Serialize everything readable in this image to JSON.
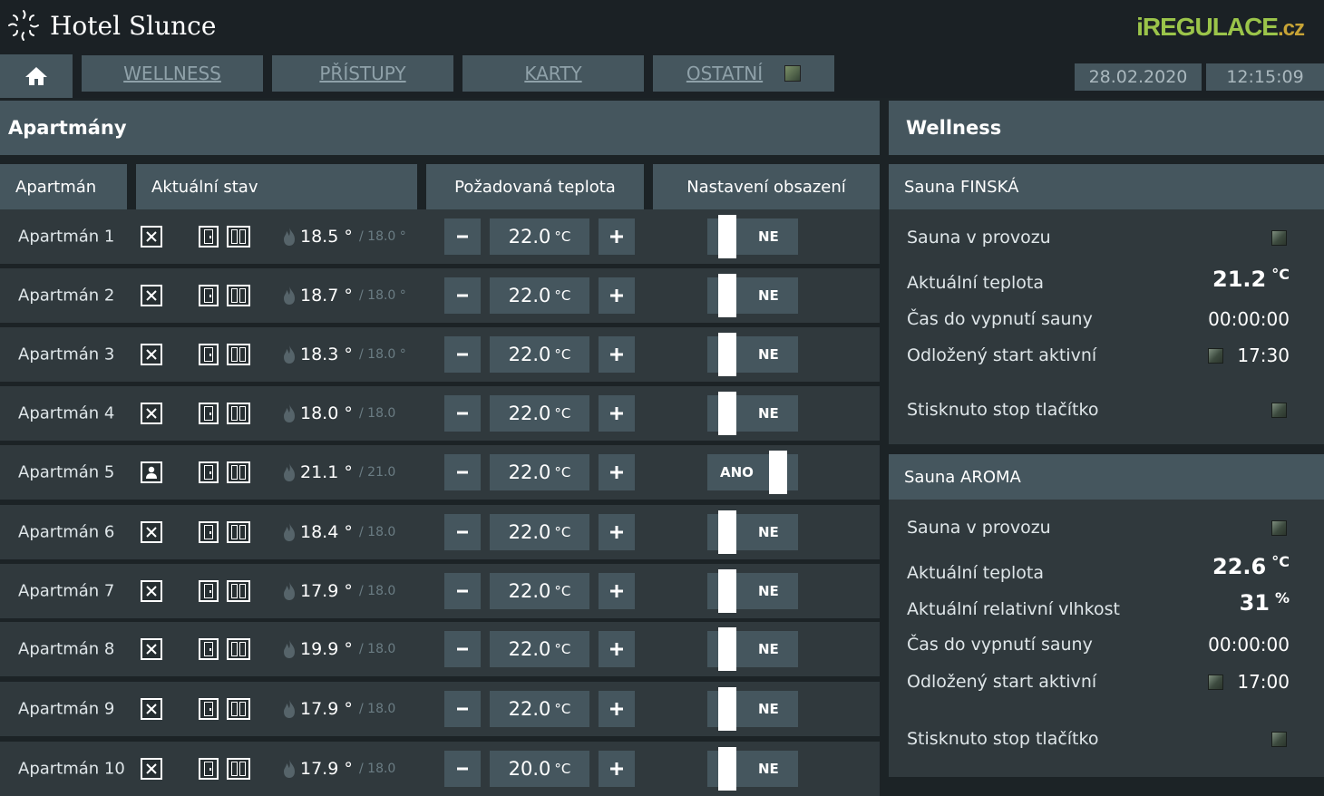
{
  "header": {
    "hotel_name": "Hotel Slunce",
    "brand_main": "iREGULACE",
    "brand_tld": ".cz",
    "home_icon": "home-icon"
  },
  "nav": {
    "tabs": [
      "WELLNESS",
      "PŘÍSTUPY",
      "KARTY",
      "OSTATNÍ"
    ],
    "date": "28.02.2020",
    "time": "12:15:09"
  },
  "apartments": {
    "title": "Apartmány",
    "columns": [
      "Apartmán",
      "Aktuální stav",
      "Požadovaná teplota",
      "Nastavení obsazení"
    ],
    "unit": "°C",
    "deg": "°",
    "rows": [
      {
        "name": "Apartmán 1",
        "temp": "18.5",
        "set": "18.0",
        "set_deg": true,
        "target": "22.0",
        "occupied": false,
        "occ_label": "NE"
      },
      {
        "name": "Apartmán 2",
        "temp": "18.7",
        "set": "18.0",
        "set_deg": true,
        "target": "22.0",
        "occupied": false,
        "occ_label": "NE"
      },
      {
        "name": "Apartmán 3",
        "temp": "18.3",
        "set": "18.0",
        "set_deg": true,
        "target": "22.0",
        "occupied": false,
        "occ_label": "NE"
      },
      {
        "name": "Apartmán 4",
        "temp": "18.0",
        "set": "18.0",
        "set_deg": false,
        "target": "22.0",
        "occupied": false,
        "occ_label": "NE"
      },
      {
        "name": "Apartmán 5",
        "temp": "21.1",
        "set": "21.0",
        "set_deg": false,
        "target": "22.0",
        "occupied": true,
        "occ_label": "ANO"
      },
      {
        "name": "Apartmán 6",
        "temp": "18.4",
        "set": "18.0",
        "set_deg": false,
        "target": "22.0",
        "occupied": false,
        "occ_label": "NE"
      },
      {
        "name": "Apartmán 7",
        "temp": "17.9",
        "set": "18.0",
        "set_deg": false,
        "target": "22.0",
        "occupied": false,
        "occ_label": "NE"
      },
      {
        "name": "Apartmán 8",
        "temp": "19.9",
        "set": "18.0",
        "set_deg": false,
        "target": "22.0",
        "occupied": false,
        "occ_label": "NE"
      },
      {
        "name": "Apartmán 9",
        "temp": "17.9",
        "set": "18.0",
        "set_deg": false,
        "target": "22.0",
        "occupied": false,
        "occ_label": "NE"
      },
      {
        "name": "Apartmán 10",
        "temp": "17.9",
        "set": "18.0",
        "set_deg": false,
        "target": "20.0",
        "occupied": false,
        "occ_label": "NE"
      }
    ]
  },
  "wellness": {
    "title": "Wellness",
    "finska": {
      "name": "Sauna FINSKÁ",
      "in_operation_label": "Sauna v provozu",
      "temp_label": "Aktuální teplota",
      "temp_value": "21.2",
      "temp_unit": "°C",
      "off_time_label": "Čas do vypnutí sauny",
      "off_time_value": "00:00:00",
      "delayed_label": "Odložený start aktivní",
      "delayed_value": "17:30",
      "stop_label": "Stisknuto stop tlačítko"
    },
    "aroma": {
      "name": "Sauna AROMA",
      "in_operation_label": "Sauna v provozu",
      "temp_label": "Aktuální teplota",
      "temp_value": "22.6",
      "temp_unit": "°C",
      "humidity_label": "Aktuální relativní vlhkost",
      "humidity_value": "31",
      "humidity_unit": "%",
      "off_time_label": "Čas do vypnutí sauny",
      "off_time_value": "00:00:00",
      "delayed_label": "Odložený start aktivní",
      "delayed_value": "17:00",
      "stop_label": "Stisknuto stop tlačítko"
    }
  },
  "colors": {
    "background": "#1c2326",
    "panel": "#45565e",
    "row": "#30393d",
    "brand_green": "#9bc44a",
    "brand_gold": "#c8a436"
  }
}
